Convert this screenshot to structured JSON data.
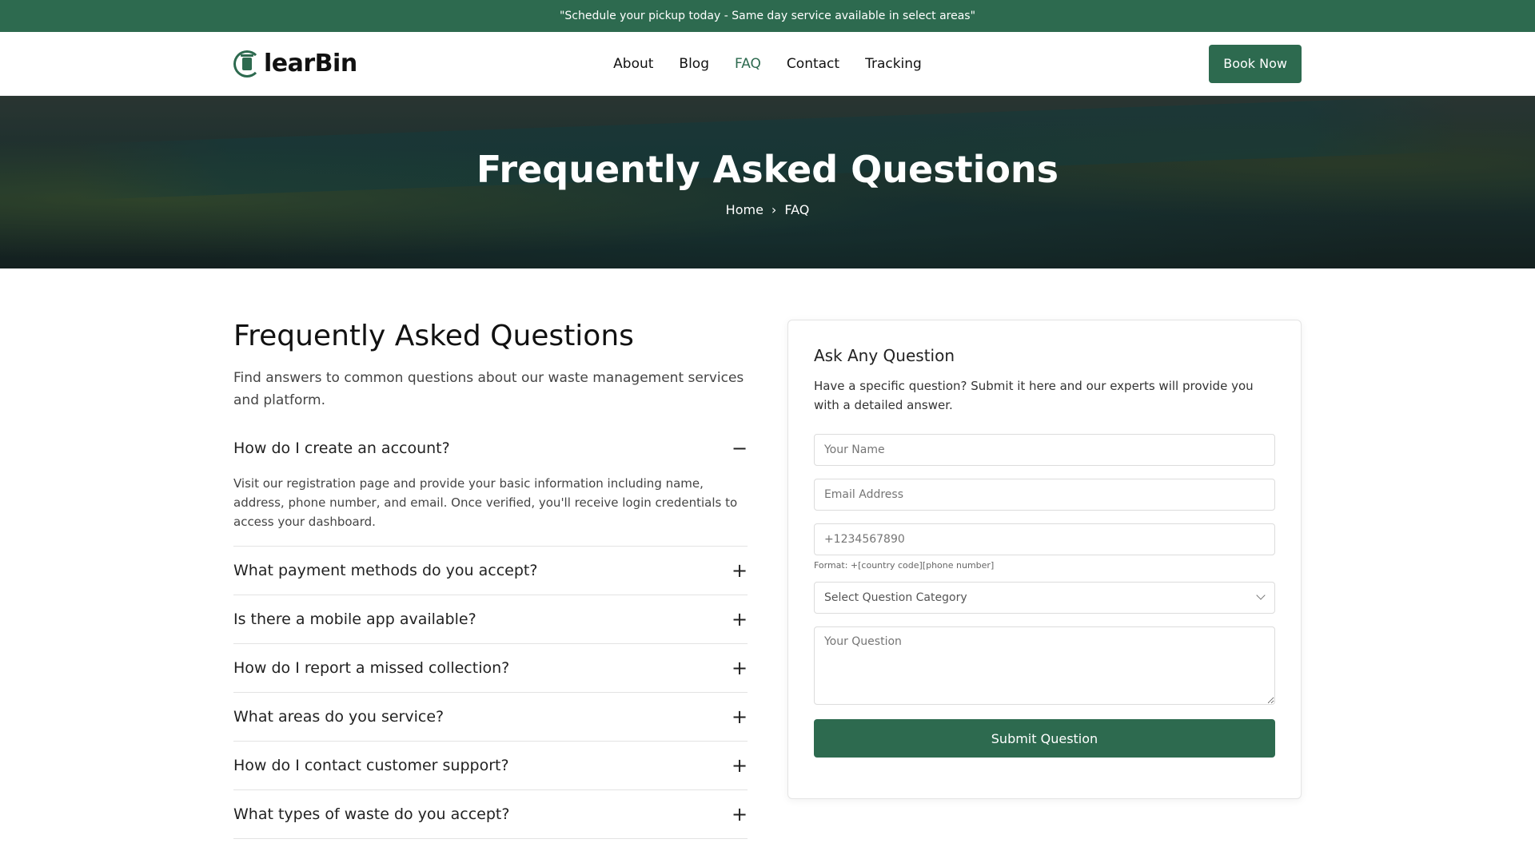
{
  "announcement": "\"Schedule your pickup today - Same day service available in select areas\"",
  "brand": {
    "logo_text": "learBin",
    "accent": "#2d6a4f"
  },
  "nav": {
    "items": [
      {
        "label": "About"
      },
      {
        "label": "Blog"
      },
      {
        "label": "FAQ"
      },
      {
        "label": "Contact"
      },
      {
        "label": "Tracking"
      }
    ],
    "active": "FAQ",
    "cta": "Book Now"
  },
  "hero": {
    "title": "Frequently Asked Questions",
    "breadcrumb": {
      "home": "Home",
      "separator": "›",
      "current": "FAQ"
    }
  },
  "faq": {
    "title": "Frequently Asked Questions",
    "subtitle": "Find answers to common questions about our waste management services and platform.",
    "items": [
      {
        "question": "How do I create an account?",
        "answer": "Visit our registration page and provide your basic information including name, address, phone number, and email. Once verified, you'll receive login credentials to access your dashboard.",
        "toggle": "−"
      },
      {
        "question": "What payment methods do you accept?",
        "toggle": "+"
      },
      {
        "question": "Is there a mobile app available?",
        "toggle": "+"
      },
      {
        "question": "How do I report a missed collection?",
        "toggle": "+"
      },
      {
        "question": "What areas do you service?",
        "toggle": "+"
      },
      {
        "question": "How do I contact customer support?",
        "toggle": "+"
      },
      {
        "question": "What types of waste do you accept?",
        "toggle": "+"
      }
    ]
  },
  "form": {
    "title": "Ask Any Question",
    "subtitle": "Have a specific question? Submit it here and our experts will provide you with a detailed answer.",
    "name_placeholder": "Your Name",
    "email_placeholder": "Email Address",
    "phone_placeholder": "+1234567890",
    "phone_hint": "Format: +[country code][phone number]",
    "category_placeholder": "Select Question Category",
    "question_placeholder": "Your Question",
    "submit_label": "Submit Question"
  }
}
